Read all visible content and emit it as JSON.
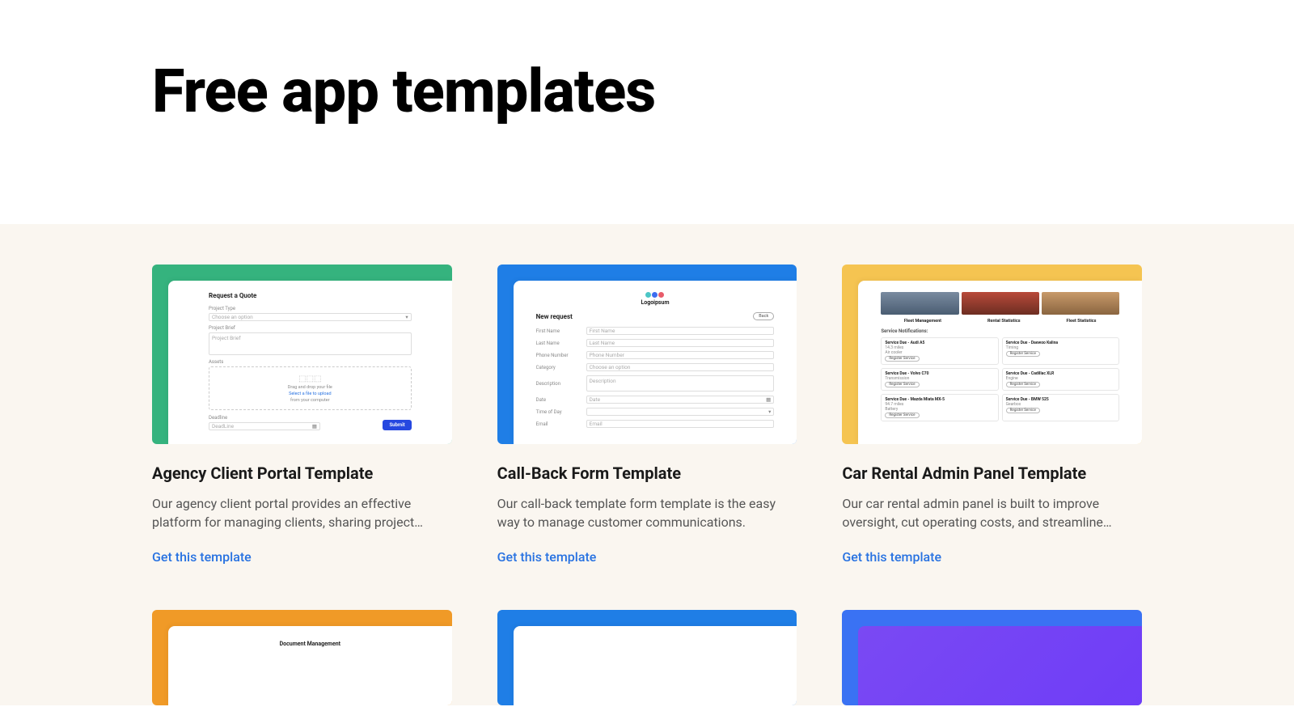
{
  "hero": {
    "title": "Free app templates"
  },
  "cta_label": "Get this template",
  "cards": [
    {
      "title": "Agency Client Portal Template",
      "desc": "Our agency client portal provides an effective platform for managing clients, sharing project…",
      "accent": "#35b37e",
      "preview": {
        "heading": "Request a Quote",
        "fields": {
          "project_type_label": "Project Type",
          "project_type_value": "Choose an option",
          "brief_label": "Project Brief",
          "brief_placeholder": "Project Brief",
          "assets_label": "Assets",
          "drop_main": "Drag and drop your file",
          "drop_link": "Select a file to upload",
          "drop_sub": "from your computer",
          "deadline_label": "Deadline",
          "deadline_value": "DeadLine",
          "submit": "Submit"
        }
      }
    },
    {
      "title": "Call-Back Form Template",
      "desc": "Our call-back template form template is the easy way to manage customer communications.",
      "accent": "#1f7ee6",
      "preview": {
        "logo_text": "Logoipsum",
        "heading": "New request",
        "back": "Back",
        "rows": [
          {
            "label": "First Name",
            "value": "First Name"
          },
          {
            "label": "Last Name",
            "value": "Last Name"
          },
          {
            "label": "Phone Number",
            "value": "Phone Number"
          },
          {
            "label": "Category",
            "value": "Choose an option"
          }
        ],
        "desc_label": "Description",
        "desc_value": "Description",
        "date_label": "Date",
        "date_value": "Date",
        "time_label": "Time of Day",
        "time_value": "",
        "email_label": "Email",
        "email_value": "Email"
      }
    },
    {
      "title": "Car Rental Admin Panel Template",
      "desc": "Our car rental admin panel is built to improve oversight, cut operating costs, and streamline…",
      "accent": "#f5c451",
      "preview": {
        "tabs": [
          "Fleet Management",
          "Rental Statistics",
          "Fleet Statistics"
        ],
        "section": "Service Notifications:",
        "items": [
          {
            "h": "Service Due - Audi A5",
            "s": "Air cooler",
            "d": "14.3 miles",
            "btn": "Register Service"
          },
          {
            "h": "Service Due - Daewoo Kalina",
            "s": "Timing",
            "btn": "Register Service"
          },
          {
            "h": "Service Due - Volvo C70",
            "s": "Transmission",
            "btn": "Register Service"
          },
          {
            "h": "Service Due - Cadillac XLR",
            "s": "Engine",
            "btn": "Register Service"
          },
          {
            "h": "Service Due - Mazda Miata MX-5",
            "s": "Battery",
            "d": "94.7 miles",
            "btn": "Register Service"
          },
          {
            "h": "Service Due - BMW 525",
            "s": "Gearbox",
            "btn": "Register Service"
          }
        ]
      }
    }
  ],
  "peek": [
    {
      "accent": "#f09a27",
      "title": "Document Management"
    },
    {
      "accent": "#1f7ee6"
    },
    {
      "accent": "#3a72f3",
      "gradient": true
    }
  ]
}
